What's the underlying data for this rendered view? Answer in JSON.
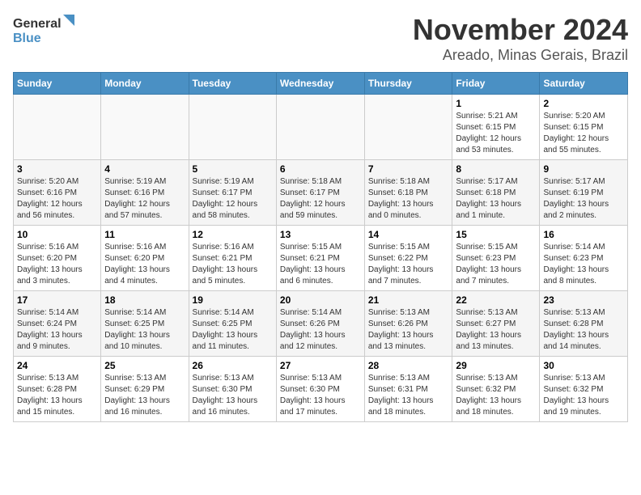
{
  "logo": {
    "text_general": "General",
    "text_blue": "Blue"
  },
  "header": {
    "month": "November 2024",
    "location": "Areado, Minas Gerais, Brazil"
  },
  "weekdays": [
    "Sunday",
    "Monday",
    "Tuesday",
    "Wednesday",
    "Thursday",
    "Friday",
    "Saturday"
  ],
  "weeks": [
    [
      {
        "day": "",
        "info": ""
      },
      {
        "day": "",
        "info": ""
      },
      {
        "day": "",
        "info": ""
      },
      {
        "day": "",
        "info": ""
      },
      {
        "day": "",
        "info": ""
      },
      {
        "day": "1",
        "info": "Sunrise: 5:21 AM\nSunset: 6:15 PM\nDaylight: 12 hours and 53 minutes."
      },
      {
        "day": "2",
        "info": "Sunrise: 5:20 AM\nSunset: 6:15 PM\nDaylight: 12 hours and 55 minutes."
      }
    ],
    [
      {
        "day": "3",
        "info": "Sunrise: 5:20 AM\nSunset: 6:16 PM\nDaylight: 12 hours and 56 minutes."
      },
      {
        "day": "4",
        "info": "Sunrise: 5:19 AM\nSunset: 6:16 PM\nDaylight: 12 hours and 57 minutes."
      },
      {
        "day": "5",
        "info": "Sunrise: 5:19 AM\nSunset: 6:17 PM\nDaylight: 12 hours and 58 minutes."
      },
      {
        "day": "6",
        "info": "Sunrise: 5:18 AM\nSunset: 6:17 PM\nDaylight: 12 hours and 59 minutes."
      },
      {
        "day": "7",
        "info": "Sunrise: 5:18 AM\nSunset: 6:18 PM\nDaylight: 13 hours and 0 minutes."
      },
      {
        "day": "8",
        "info": "Sunrise: 5:17 AM\nSunset: 6:18 PM\nDaylight: 13 hours and 1 minute."
      },
      {
        "day": "9",
        "info": "Sunrise: 5:17 AM\nSunset: 6:19 PM\nDaylight: 13 hours and 2 minutes."
      }
    ],
    [
      {
        "day": "10",
        "info": "Sunrise: 5:16 AM\nSunset: 6:20 PM\nDaylight: 13 hours and 3 minutes."
      },
      {
        "day": "11",
        "info": "Sunrise: 5:16 AM\nSunset: 6:20 PM\nDaylight: 13 hours and 4 minutes."
      },
      {
        "day": "12",
        "info": "Sunrise: 5:16 AM\nSunset: 6:21 PM\nDaylight: 13 hours and 5 minutes."
      },
      {
        "day": "13",
        "info": "Sunrise: 5:15 AM\nSunset: 6:21 PM\nDaylight: 13 hours and 6 minutes."
      },
      {
        "day": "14",
        "info": "Sunrise: 5:15 AM\nSunset: 6:22 PM\nDaylight: 13 hours and 7 minutes."
      },
      {
        "day": "15",
        "info": "Sunrise: 5:15 AM\nSunset: 6:23 PM\nDaylight: 13 hours and 7 minutes."
      },
      {
        "day": "16",
        "info": "Sunrise: 5:14 AM\nSunset: 6:23 PM\nDaylight: 13 hours and 8 minutes."
      }
    ],
    [
      {
        "day": "17",
        "info": "Sunrise: 5:14 AM\nSunset: 6:24 PM\nDaylight: 13 hours and 9 minutes."
      },
      {
        "day": "18",
        "info": "Sunrise: 5:14 AM\nSunset: 6:25 PM\nDaylight: 13 hours and 10 minutes."
      },
      {
        "day": "19",
        "info": "Sunrise: 5:14 AM\nSunset: 6:25 PM\nDaylight: 13 hours and 11 minutes."
      },
      {
        "day": "20",
        "info": "Sunrise: 5:14 AM\nSunset: 6:26 PM\nDaylight: 13 hours and 12 minutes."
      },
      {
        "day": "21",
        "info": "Sunrise: 5:13 AM\nSunset: 6:26 PM\nDaylight: 13 hours and 13 minutes."
      },
      {
        "day": "22",
        "info": "Sunrise: 5:13 AM\nSunset: 6:27 PM\nDaylight: 13 hours and 13 minutes."
      },
      {
        "day": "23",
        "info": "Sunrise: 5:13 AM\nSunset: 6:28 PM\nDaylight: 13 hours and 14 minutes."
      }
    ],
    [
      {
        "day": "24",
        "info": "Sunrise: 5:13 AM\nSunset: 6:28 PM\nDaylight: 13 hours and 15 minutes."
      },
      {
        "day": "25",
        "info": "Sunrise: 5:13 AM\nSunset: 6:29 PM\nDaylight: 13 hours and 16 minutes."
      },
      {
        "day": "26",
        "info": "Sunrise: 5:13 AM\nSunset: 6:30 PM\nDaylight: 13 hours and 16 minutes."
      },
      {
        "day": "27",
        "info": "Sunrise: 5:13 AM\nSunset: 6:30 PM\nDaylight: 13 hours and 17 minutes."
      },
      {
        "day": "28",
        "info": "Sunrise: 5:13 AM\nSunset: 6:31 PM\nDaylight: 13 hours and 18 minutes."
      },
      {
        "day": "29",
        "info": "Sunrise: 5:13 AM\nSunset: 6:32 PM\nDaylight: 13 hours and 18 minutes."
      },
      {
        "day": "30",
        "info": "Sunrise: 5:13 AM\nSunset: 6:32 PM\nDaylight: 13 hours and 19 minutes."
      }
    ]
  ]
}
